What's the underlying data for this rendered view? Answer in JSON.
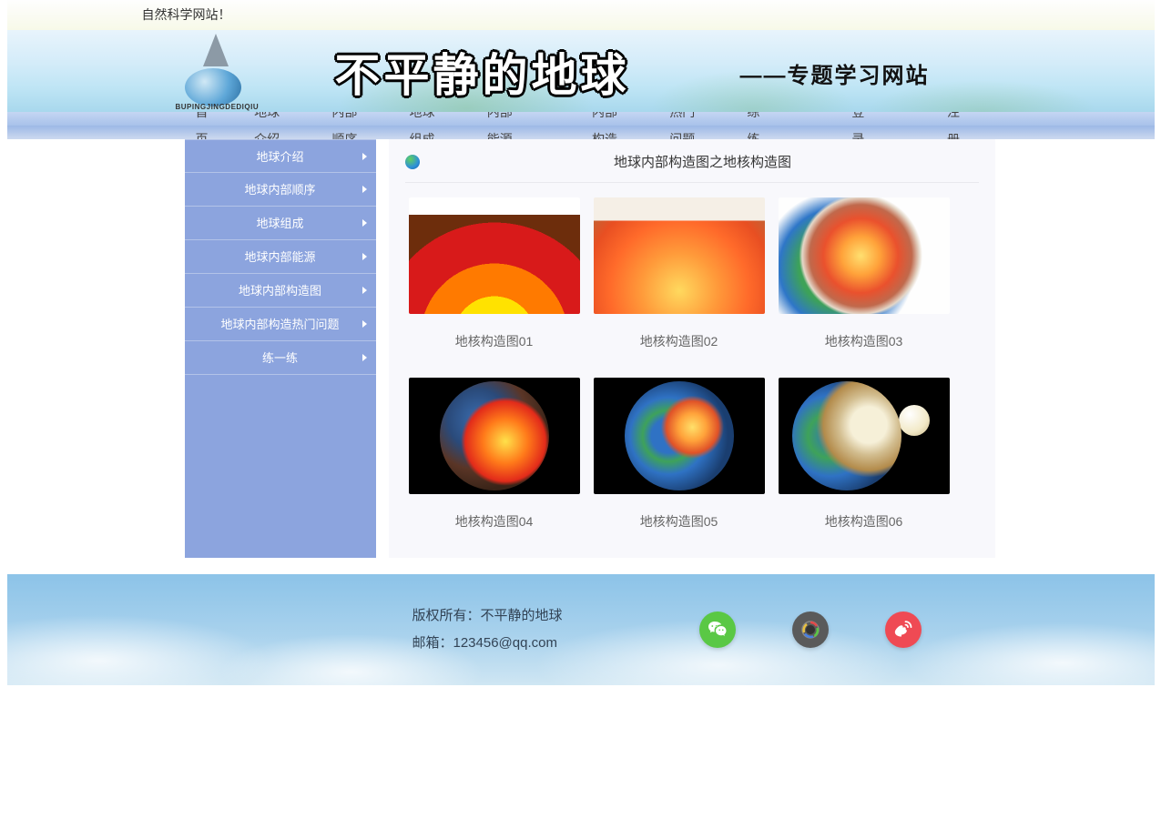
{
  "announcement": "自然科学网站！",
  "header": {
    "logo_subtext": "BUPINGJINGDEDIQIU",
    "title": "不平静的地球",
    "subtitle": "——专题学习网站"
  },
  "nav": {
    "items": [
      "首页",
      "地球介绍",
      "内部顺序",
      "地球组成",
      "内部能源",
      "内部构造",
      "热门问题",
      "练一练",
      "登录",
      "注册"
    ]
  },
  "sidebar": {
    "items": [
      "地球介绍",
      "地球内部顺序",
      "地球组成",
      "地球内部能源",
      "地球内部构造图",
      "地球内部构造热门问题",
      "练一练"
    ]
  },
  "main": {
    "title": "地球内部构造图之地核构造图",
    "gallery": [
      "地核构造图01",
      "地核构造图02",
      "地核构造图03",
      "地核构造图04",
      "地核构造图05",
      "地核构造图06"
    ]
  },
  "footer": {
    "copyright": "版权所有：不平静的地球",
    "email": "邮箱：123456@qq.com"
  }
}
